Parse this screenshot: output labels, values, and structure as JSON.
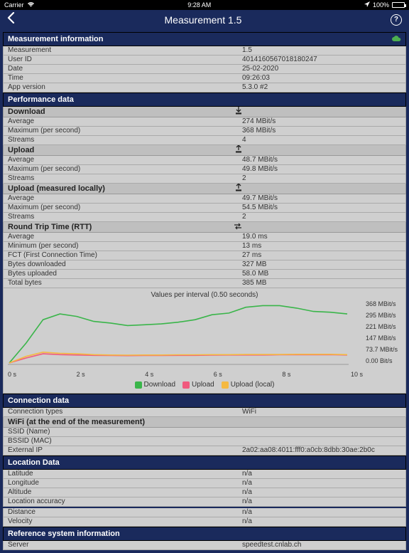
{
  "status": {
    "carrier": "Carrier",
    "time": "9:28 AM",
    "battery": "100%"
  },
  "nav": {
    "title": "Measurement 1.5"
  },
  "sections": {
    "measurement_info": {
      "title": "Measurement information",
      "rows": [
        {
          "label": "Measurement",
          "value": "1.5"
        },
        {
          "label": "User ID",
          "value": "4014160567018180247"
        },
        {
          "label": "Date",
          "value": "25-02-2020"
        },
        {
          "label": "Time",
          "value": "09:26:03"
        },
        {
          "label": "App version",
          "value": "5.3.0 #2"
        }
      ]
    },
    "performance": {
      "title": "Performance data",
      "groups": [
        {
          "header": "Download",
          "icon": "download",
          "rows": [
            {
              "label": "Average",
              "value": "274 MBit/s"
            },
            {
              "label": "Maximum (per second)",
              "value": "368 MBit/s"
            },
            {
              "label": "Streams",
              "value": "4"
            }
          ]
        },
        {
          "header": "Upload",
          "icon": "upload",
          "rows": [
            {
              "label": "Average",
              "value": "48.7 MBit/s"
            },
            {
              "label": "Maximum (per second)",
              "value": "49.8 MBit/s"
            },
            {
              "label": "Streams",
              "value": "2"
            }
          ]
        },
        {
          "header": "Upload (measured locally)",
          "icon": "upload",
          "rows": [
            {
              "label": "Average",
              "value": "49.7 MBit/s"
            },
            {
              "label": "Maximum (per second)",
              "value": "54.5 MBit/s"
            },
            {
              "label": "Streams",
              "value": "2"
            }
          ]
        },
        {
          "header": "Round Trip Time (RTT)",
          "icon": "swap",
          "rows": [
            {
              "label": "Average",
              "value": "19.0 ms"
            },
            {
              "label": "Minimum (per second)",
              "value": "13 ms"
            }
          ]
        }
      ],
      "extra_rows": [
        {
          "label": "FCT (First Connection Time)",
          "value": "27 ms"
        },
        {
          "label": "Bytes downloaded",
          "value": "327 MB"
        },
        {
          "label": "Bytes uploaded",
          "value": "58.0 MB"
        },
        {
          "label": "Total bytes",
          "value": "385 MB"
        }
      ]
    },
    "connection": {
      "title": "Connection data",
      "rows": [
        {
          "label": "Connection types",
          "value": "WiFi"
        }
      ],
      "sub": {
        "header": "WiFi (at the end of the measurement)",
        "rows": [
          {
            "label": "SSID (Name)",
            "value": ""
          },
          {
            "label": "BSSID (MAC)",
            "value": ""
          },
          {
            "label": "External IP",
            "value": "2a02:aa08:4011:fff0:a0cb:8dbb:30ae:2b0c"
          }
        ]
      }
    },
    "location": {
      "title": "Location Data",
      "rows": [
        {
          "label": "Latitude",
          "value": "n/a"
        },
        {
          "label": "Longitude",
          "value": "n/a"
        },
        {
          "label": "Altitude",
          "value": "n/a"
        },
        {
          "label": "Location accuracy",
          "value": "n/a"
        }
      ],
      "extra": [
        {
          "label": "Distance",
          "value": "n/a"
        },
        {
          "label": "Velocity",
          "value": "n/a"
        }
      ]
    },
    "reference": {
      "title": "Reference system information",
      "rows": [
        {
          "label": "Server",
          "value": "speedtest.cnlab.ch"
        }
      ]
    }
  },
  "chart_data": {
    "type": "line",
    "title": "Values per interval (0.50 seconds)",
    "x": [
      0,
      0.5,
      1,
      1.5,
      2,
      2.5,
      3,
      3.5,
      4,
      4.5,
      5,
      5.5,
      6,
      6.5,
      7,
      7.5,
      8,
      8.5,
      9,
      9.5,
      10
    ],
    "xlabel_ticks": [
      "0 s",
      "2 s",
      "4 s",
      "6 s",
      "8 s",
      "10 s"
    ],
    "ylabel_ticks": [
      "368 MBit/s",
      "295 MBit/s",
      "221 MBit/s",
      "147 MBit/s",
      "73.7 MBit/s",
      "0.00 Bit/s"
    ],
    "ylim": [
      0,
      368
    ],
    "series": [
      {
        "name": "Download",
        "color": "#3ab54a",
        "values": [
          0,
          120,
          260,
          295,
          280,
          250,
          240,
          225,
          230,
          235,
          245,
          260,
          290,
          300,
          335,
          345,
          345,
          330,
          310,
          305,
          295
        ]
      },
      {
        "name": "Upload",
        "color": "#f05a7e",
        "values": [
          0,
          30,
          55,
          50,
          48,
          46,
          45,
          44,
          45,
          45,
          46,
          46,
          47,
          48,
          48,
          48,
          49,
          49,
          49,
          50,
          48
        ]
      },
      {
        "name": "Upload (local)",
        "color": "#f5b942",
        "values": [
          0,
          40,
          65,
          58,
          55,
          50,
          48,
          47,
          48,
          48,
          49,
          49,
          50,
          50,
          51,
          51,
          51,
          52,
          52,
          52,
          50
        ]
      }
    ],
    "legend": [
      "Download",
      "Upload",
      "Upload (local)"
    ]
  }
}
